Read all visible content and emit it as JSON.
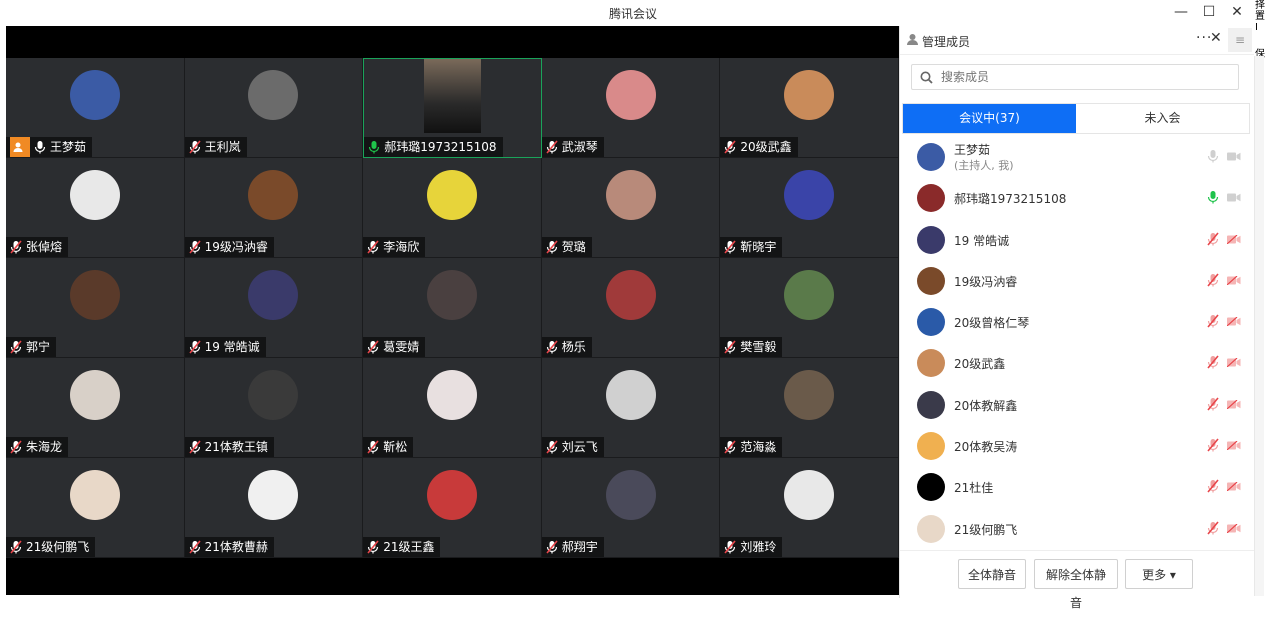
{
  "window": {
    "title": "腾讯会议"
  },
  "corner_fragments": [
    "择",
    "置I",
    "保"
  ],
  "tiles": [
    {
      "name": "王梦茹",
      "mic": "on",
      "host": true,
      "avatar": "#3b5ba5"
    },
    {
      "name": "王利岚",
      "mic": "off",
      "avatar": "#6b6b6b"
    },
    {
      "name": "郝玮璐1973215108",
      "mic": "active",
      "live": true,
      "avatar": "#444"
    },
    {
      "name": "武淑琴",
      "mic": "off",
      "avatar": "#d98a8a"
    },
    {
      "name": "20级武鑫",
      "mic": "off",
      "avatar": "#c98b5a"
    },
    {
      "name": "张倬熔",
      "mic": "off",
      "avatar": "#e8e8e8"
    },
    {
      "name": "19级冯汭睿",
      "mic": "off",
      "avatar": "#7a4a2a"
    },
    {
      "name": "李海欣",
      "mic": "off",
      "avatar": "#e7d43a"
    },
    {
      "name": "贺璐",
      "mic": "off",
      "avatar": "#b88a7a"
    },
    {
      "name": "靳晓宇",
      "mic": "off",
      "avatar": "#3a44a8"
    },
    {
      "name": "郭宁",
      "mic": "off",
      "avatar": "#5a3a2a"
    },
    {
      "name": "19  常皓诚",
      "mic": "off",
      "avatar": "#3a3a6a"
    },
    {
      "name": "葛雯婧",
      "mic": "off",
      "avatar": "#4a4040"
    },
    {
      "name": "杨乐",
      "mic": "off",
      "avatar": "#a03a3a"
    },
    {
      "name": "樊雪毅",
      "mic": "off",
      "avatar": "#5a7a4a"
    },
    {
      "name": "朱海龙",
      "mic": "off",
      "avatar": "#d8d0c8"
    },
    {
      "name": "21体教王镇",
      "mic": "off",
      "avatar": "#3a3a3a"
    },
    {
      "name": "靳松",
      "mic": "off",
      "avatar": "#e8e0e0"
    },
    {
      "name": "刘云飞",
      "mic": "off",
      "avatar": "#d0d0d0"
    },
    {
      "name": "范海淼",
      "mic": "off",
      "avatar": "#6a5a4a"
    },
    {
      "name": "21级何鹏飞",
      "mic": "off",
      "avatar": "#e8d8c8"
    },
    {
      "name": "21体教曹赫",
      "mic": "off",
      "avatar": "#f0f0f0"
    },
    {
      "name": "21级王鑫",
      "mic": "off",
      "avatar": "#c83a3a"
    },
    {
      "name": "郝翔宇",
      "mic": "off",
      "avatar": "#4a4a5a"
    },
    {
      "name": "刘雅玲",
      "mic": "off",
      "avatar": "#e8e8e8"
    }
  ],
  "panel": {
    "title": "管理成员",
    "more": "···",
    "close": "✕",
    "menu": "≡",
    "search_placeholder": "搜索成员",
    "tab_in": "会议中(37)",
    "tab_out": "未入会",
    "members": [
      {
        "name": "王梦茹",
        "sub": "(主持人, 我)",
        "mic": "grey",
        "avatar": "#3b5ba5"
      },
      {
        "name": "郝玮璐1973215108",
        "mic": "green",
        "avatar": "#8a2a2a"
      },
      {
        "name": "19  常皓诚",
        "mic": "muted",
        "avatar": "#3a3a6a"
      },
      {
        "name": "19级冯汭睿",
        "mic": "muted",
        "avatar": "#7a4a2a"
      },
      {
        "name": "20级曾格仁琴",
        "mic": "muted",
        "avatar": "#2a5aa8"
      },
      {
        "name": "20级武鑫",
        "mic": "muted",
        "avatar": "#c98b5a"
      },
      {
        "name": "20体教解鑫",
        "mic": "muted",
        "avatar": "#3a3a4a"
      },
      {
        "name": "20体教吴涛",
        "mic": "muted",
        "avatar": "#f0b050"
      },
      {
        "name": "21杜佳",
        "mic": "muted",
        "avatar": "#000000"
      },
      {
        "name": "21级何鹏飞",
        "mic": "muted",
        "avatar": "#e8d8c8"
      }
    ],
    "buttons": {
      "mute_all": "全体静音",
      "unmute_all": "解除全体静音",
      "more": "更多 ▾"
    }
  },
  "colors": {
    "accent": "#0e6ef5",
    "muted_red": "#e8454a",
    "active_green": "#1fc34b",
    "host_orange": "#f08a24"
  }
}
